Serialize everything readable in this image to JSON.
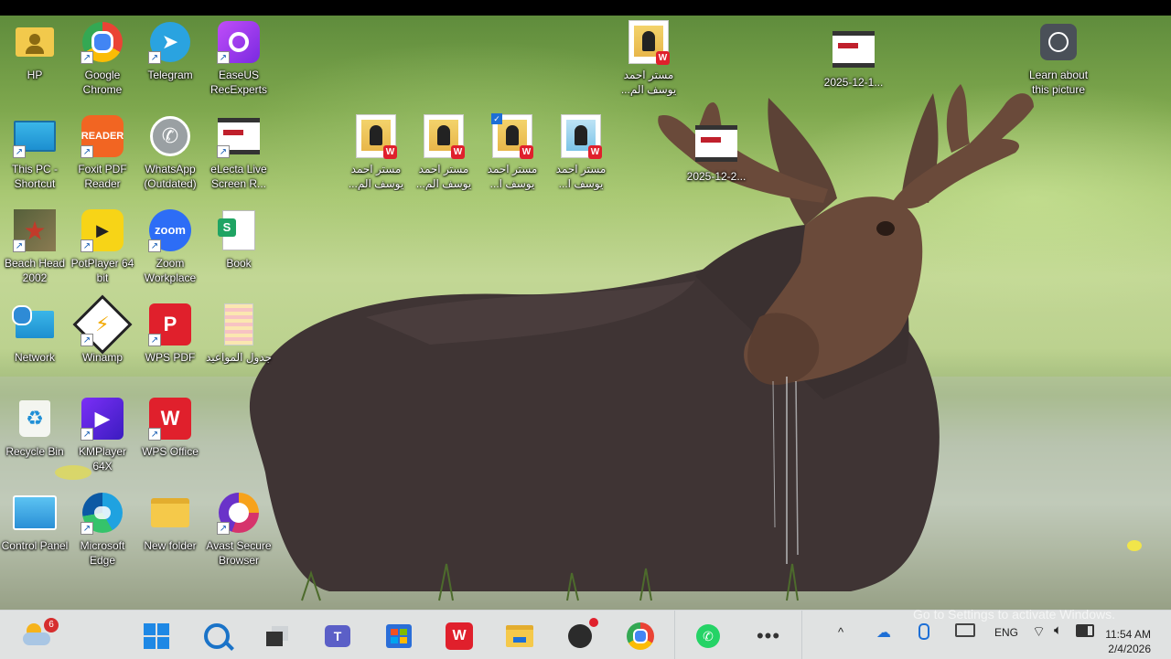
{
  "desktop": {
    "icons": [
      {
        "label": "HP",
        "icon": "folder-user-icon"
      },
      {
        "label": "Google Chrome",
        "icon": "chrome-icon"
      },
      {
        "label": "Telegram",
        "icon": "telegram-icon"
      },
      {
        "label": "EaseUS RecExperts",
        "icon": "easeus-icon"
      },
      {
        "label": "This PC - Shortcut",
        "icon": "monitor-icon"
      },
      {
        "label": "Foxit PDF Reader",
        "icon": "foxit-icon"
      },
      {
        "label": "WhatsApp (Outdated)",
        "icon": "whatsapp-icon"
      },
      {
        "label": "eLecta Live Screen R...",
        "icon": "film-icon"
      },
      {
        "label": "Beach Head 2002",
        "icon": "medal-icon"
      },
      {
        "label": "PotPlayer 64 bit",
        "icon": "potplayer-icon"
      },
      {
        "label": "Zoom Workplace",
        "icon": "zoom-icon"
      },
      {
        "label": "Book",
        "icon": "spreadsheet-icon"
      },
      {
        "label": "Network",
        "icon": "network-icon"
      },
      {
        "label": "Winamp",
        "icon": "winamp-icon"
      },
      {
        "label": "WPS PDF",
        "icon": "wps-pdf-icon"
      },
      {
        "label": "جدول المواعيد",
        "icon": "document-icon"
      },
      {
        "label": "Recycle Bin",
        "icon": "recycle-bin-icon"
      },
      {
        "label": "KMPlayer 64X",
        "icon": "kmplayer-icon"
      },
      {
        "label": "WPS Office",
        "icon": "wps-office-icon"
      },
      {
        "label": "Control Panel",
        "icon": "control-panel-icon"
      },
      {
        "label": "Microsoft Edge",
        "icon": "edge-icon"
      },
      {
        "label": "New folder",
        "icon": "folder-icon"
      },
      {
        "label": "Avast Secure Browser",
        "icon": "avast-icon"
      }
    ],
    "files": [
      {
        "label": "مستر احمد يوسف الم...",
        "icon": "wps-document-icon"
      },
      {
        "label": "مستر احمد يوسف الم...",
        "icon": "wps-document-icon"
      },
      {
        "label": "مستر احمد يوسف ا...",
        "icon": "wps-document-icon"
      },
      {
        "label": "مستر احمد يوسف ا...",
        "icon": "wps-document-icon"
      },
      {
        "label": "مستر احمد يوسف الم...",
        "icon": "wps-document-icon"
      },
      {
        "label": "2025-12-1...",
        "icon": "video-file-icon"
      },
      {
        "label": "2025-12-2...",
        "icon": "video-file-icon"
      }
    ],
    "learn": {
      "label": "Learn about this picture",
      "icon": "camera-icon"
    },
    "watermark": "Go to Settings to activate Windows."
  },
  "taskbar": {
    "widgets_badge": "6",
    "apps": [
      "start-icon",
      "search-icon",
      "task-view-icon",
      "teams-icon",
      "store-icon",
      "wps-icon",
      "file-explorer-icon",
      "obs-icon",
      "chrome-icon",
      "whatsapp-icon",
      "more-icon"
    ],
    "language": "ENG",
    "time": "11:54 AM",
    "date": "2/4/2026"
  },
  "colors": {
    "accent": "#0067c0",
    "wps_red": "#e0202c"
  }
}
